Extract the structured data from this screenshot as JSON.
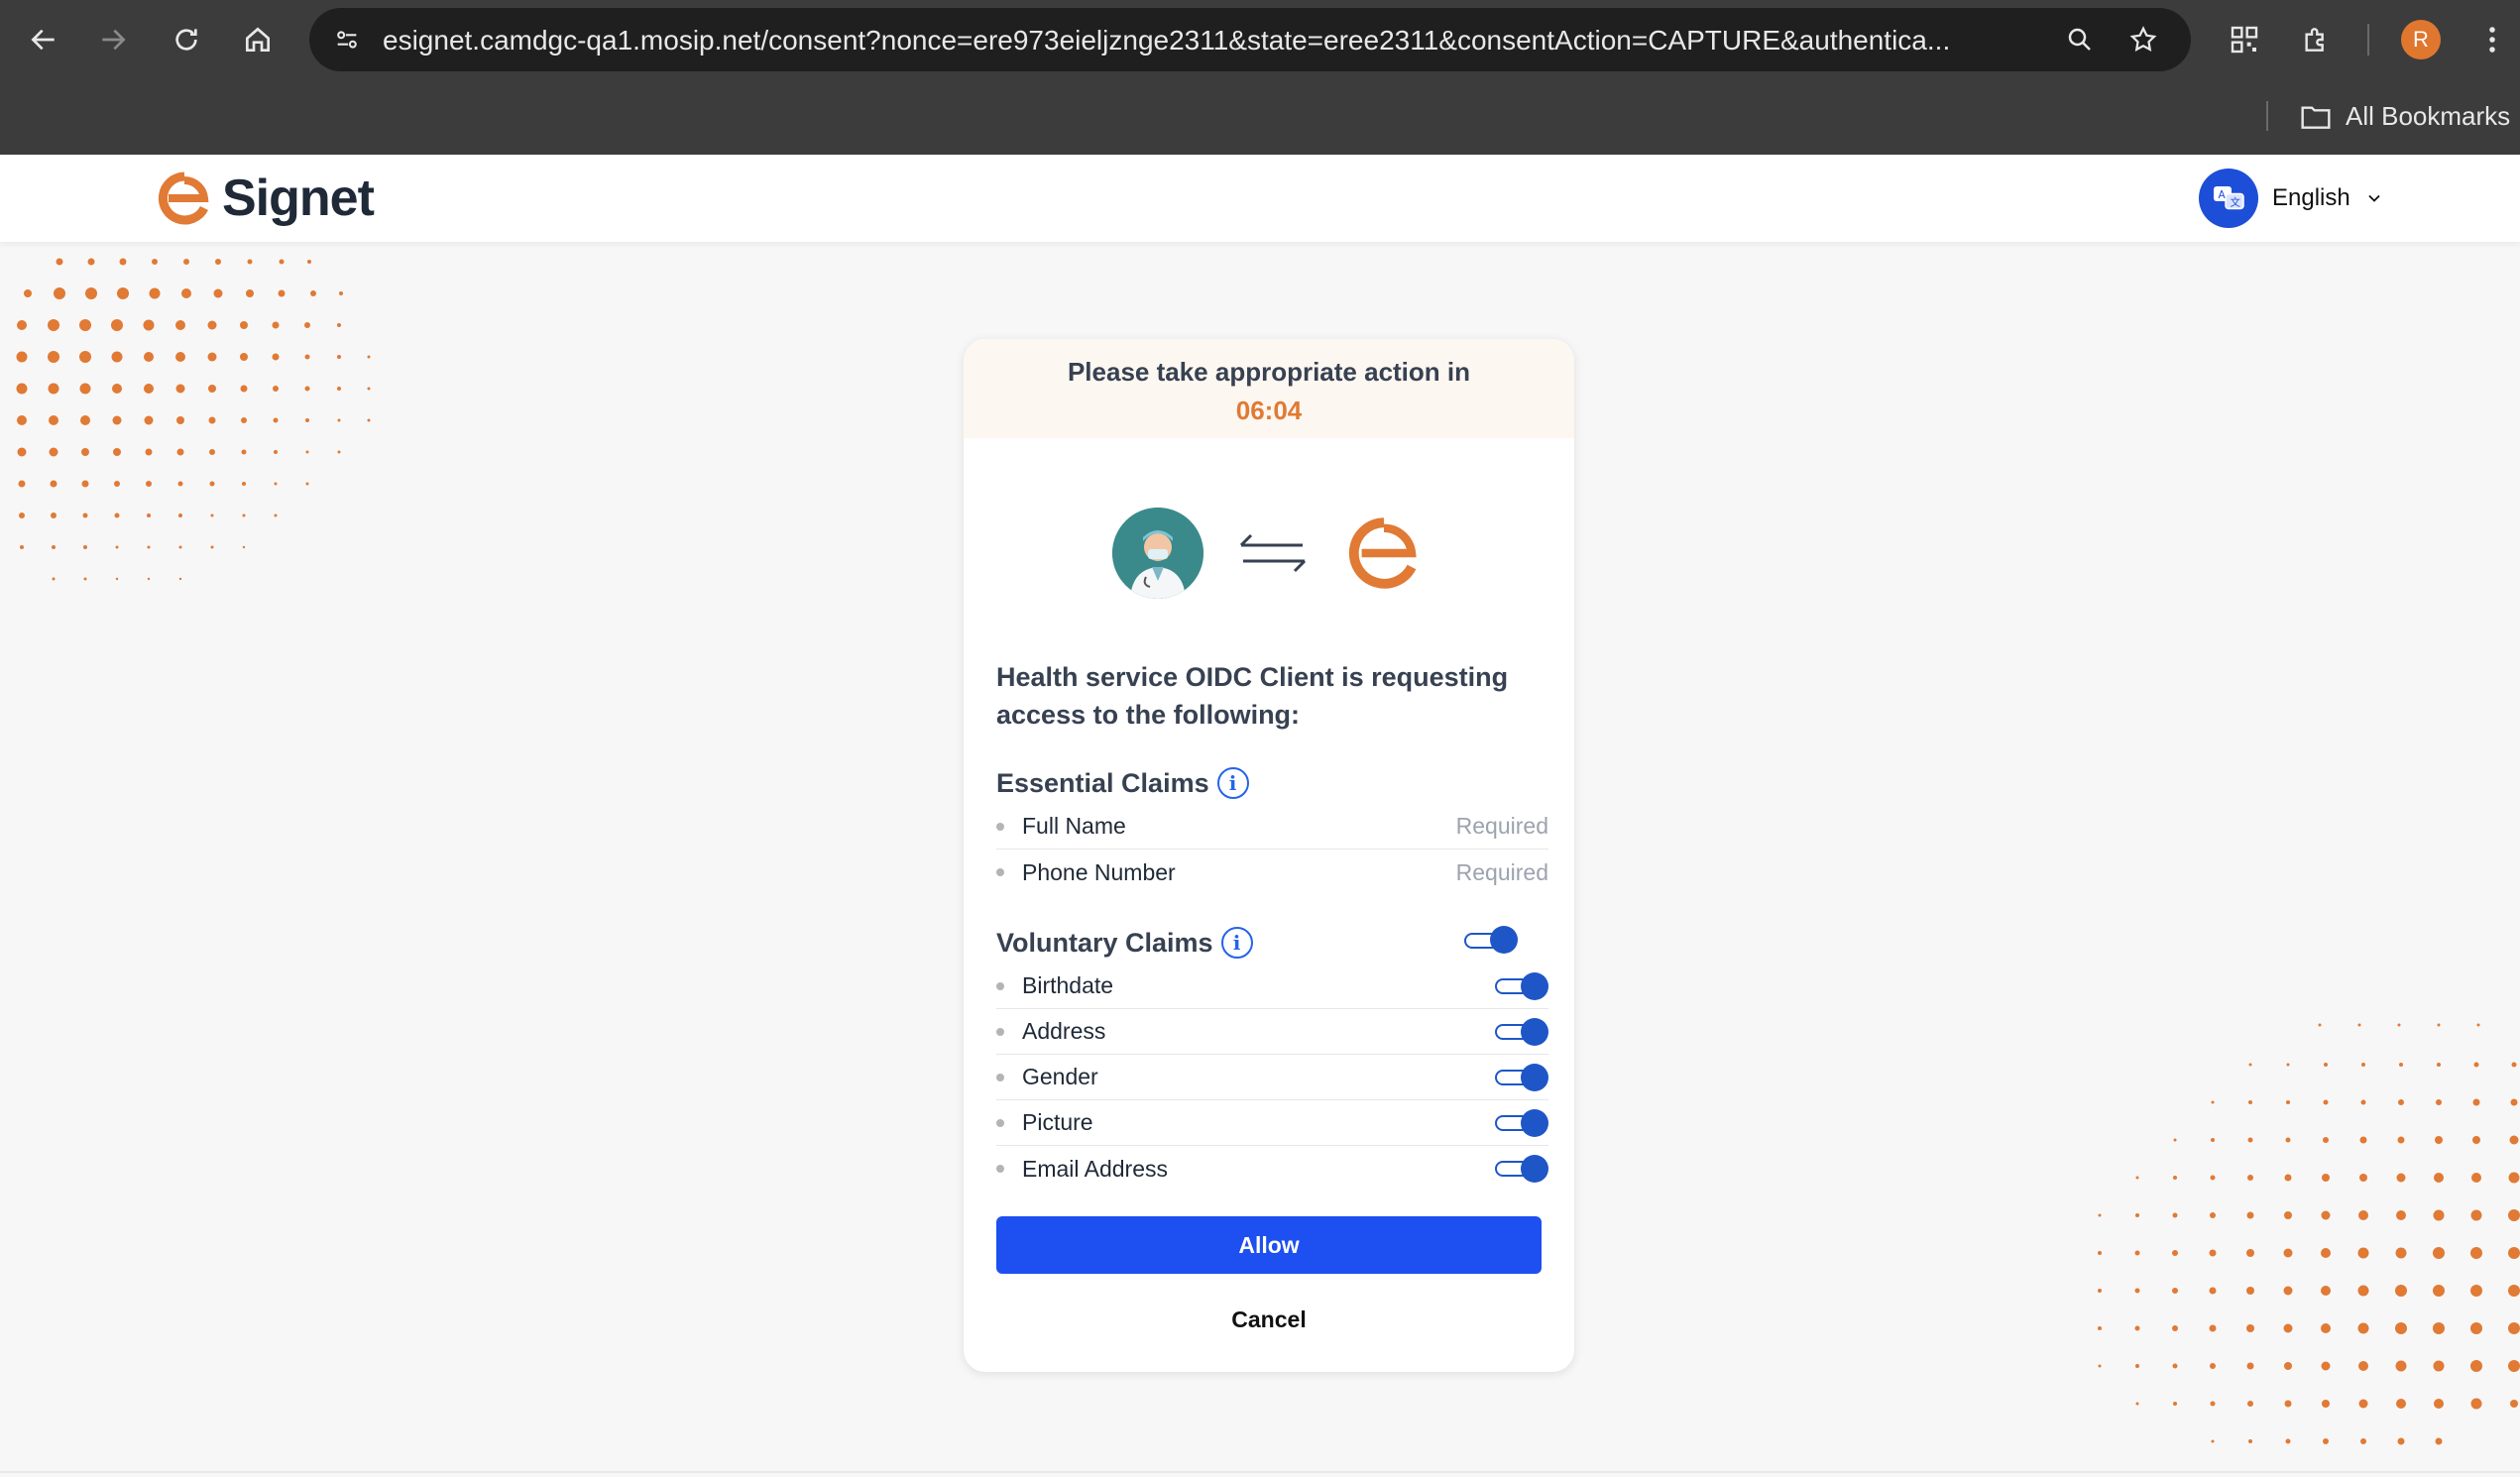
{
  "browser": {
    "url": "esignet.camdgc-qa1.mosip.net/consent?nonce=ere973eieljznge2311&state=eree2311&consentAction=CAPTURE&authentica...",
    "bookmarks_label": "All Bookmarks",
    "profile_initial": "R"
  },
  "header": {
    "logo_text": "Signet",
    "language": "English"
  },
  "card": {
    "timer_message": "Please take appropriate action in",
    "timer_value": "06:04",
    "request_text": "Health service OIDC Client is requesting access to the following:",
    "essential_title": "Essential Claims",
    "essential_claims": [
      {
        "name": "Full Name",
        "status": "Required"
      },
      {
        "name": "Phone Number",
        "status": "Required"
      }
    ],
    "voluntary_title": "Voluntary Claims",
    "voluntary_claims": [
      {
        "name": "Birthdate",
        "enabled": true
      },
      {
        "name": "Address",
        "enabled": true
      },
      {
        "name": "Gender",
        "enabled": true
      },
      {
        "name": "Picture",
        "enabled": true
      },
      {
        "name": "Email Address",
        "enabled": true
      }
    ],
    "allow_label": "Allow",
    "cancel_label": "Cancel"
  },
  "colors": {
    "brand_orange": "#e07a34",
    "primary_blue": "#1e4ff0",
    "toggle_blue": "#1e56c7"
  }
}
